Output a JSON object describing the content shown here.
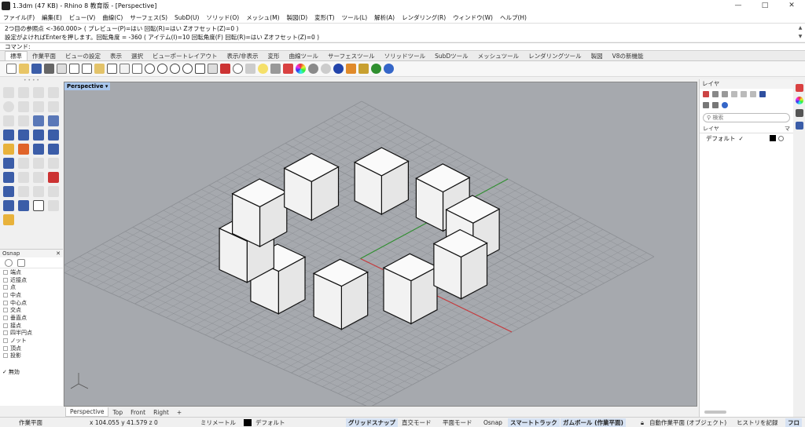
{
  "window": {
    "title": "1.3dm (47 KB) - Rhino 8 教育版 - [Perspective]",
    "controls": [
      "—",
      "□",
      "✕"
    ]
  },
  "menu": [
    "ファイル(F)",
    "編集(E)",
    "ビュー(V)",
    "曲線(C)",
    "サーフェス(S)",
    "SubD(U)",
    "ソリッド(O)",
    "メッシュ(M)",
    "製図(D)",
    "変形(T)",
    "ツール(L)",
    "解析(A)",
    "レンダリング(R)",
    "ウィンドウ(W)",
    "ヘルプ(H)"
  ],
  "command": {
    "history": [
      "2つ目の参照点 <-360.000> ( プレビュー(P)=はい 回転(R)=はい Zオフセット(Z)=0 )",
      "設定がよければEnterを押します。回転角度 = -360 ( アイテム(I)=10 回転角度(F) 回転(R)=はい Zオフセット(Z)=0 )"
    ],
    "prompt": "コマンド:"
  },
  "toolbar_tabs": [
    "標準",
    "作業平面",
    "ビューの設定",
    "表示",
    "選択",
    "ビューポートレイアウト",
    "表示/非表示",
    "変形",
    "曲線ツール",
    "サーフェスツール",
    "ソリッドツール",
    "SubDツール",
    "メッシュツール",
    "レンダリングツール",
    "製図",
    "V8の新機能"
  ],
  "active_toolbar_tab": "標準",
  "toolbar_icons": [
    "new-file-icon",
    "open-file-icon",
    "save-icon",
    "print-icon",
    "import-icon",
    "cut-icon",
    "copy-icon",
    "paste-icon",
    "undo-icon",
    "pan-icon",
    "rotate-view-icon",
    "zoom-icon",
    "zoom-window-icon",
    "zoom-extents-icon",
    "zoom-selected-icon",
    "viewport-4-icon",
    "set-camera-icon",
    "car-icon",
    "rotate-3d-icon",
    "points-icon",
    "light-icon",
    "lock-icon",
    "layer-icon",
    "color-wheel-icon",
    "material-ball-icon",
    "render-sphere-icon",
    "environment-icon",
    "rendered-sphere-icon",
    "options-icon",
    "grasshopper-icon",
    "help-icon"
  ],
  "osnap": {
    "title": "Osnap",
    "items": [
      "端点",
      "近接点",
      "点",
      "中点",
      "中心点",
      "交点",
      "垂直点",
      "接点",
      "四半円点",
      "ノット",
      "頂点",
      "投影"
    ],
    "disable_label": "無効"
  },
  "viewport": {
    "label": "Perspective",
    "tabs": [
      "Perspective",
      "Top",
      "Front",
      "Right",
      "+"
    ],
    "active_tab": "Perspective",
    "axis_colors": {
      "x": "#c8383b",
      "y": "#2f8f2f",
      "z": "#3355aa"
    },
    "grid_color": "#8d9095",
    "background": "#a6a9ae",
    "box_count": 10
  },
  "layers": {
    "title": "レイヤ",
    "search_placeholder": "検索",
    "column_name": "レイヤ",
    "column_mat": "マ",
    "rows": [
      {
        "name": "デフォルト",
        "current_mark": "✓",
        "color": "#000000"
      }
    ]
  },
  "status": {
    "cplane": "作業平面",
    "coords": "x 104.055   y 41.579   z 0",
    "units": "ミリメートル",
    "layer": "デフォルト",
    "grid_snap": "グリッドスナップ",
    "ortho": "直交モード",
    "planar": "平面モード",
    "osnap": "Osnap",
    "smarttrack": "スマートトラック",
    "gumball": "ガムボール (作業平面)",
    "auto_cplane": "自動作業平面 (オブジェクト)",
    "history": "ヒストリを記録",
    "filter": "フロ"
  }
}
